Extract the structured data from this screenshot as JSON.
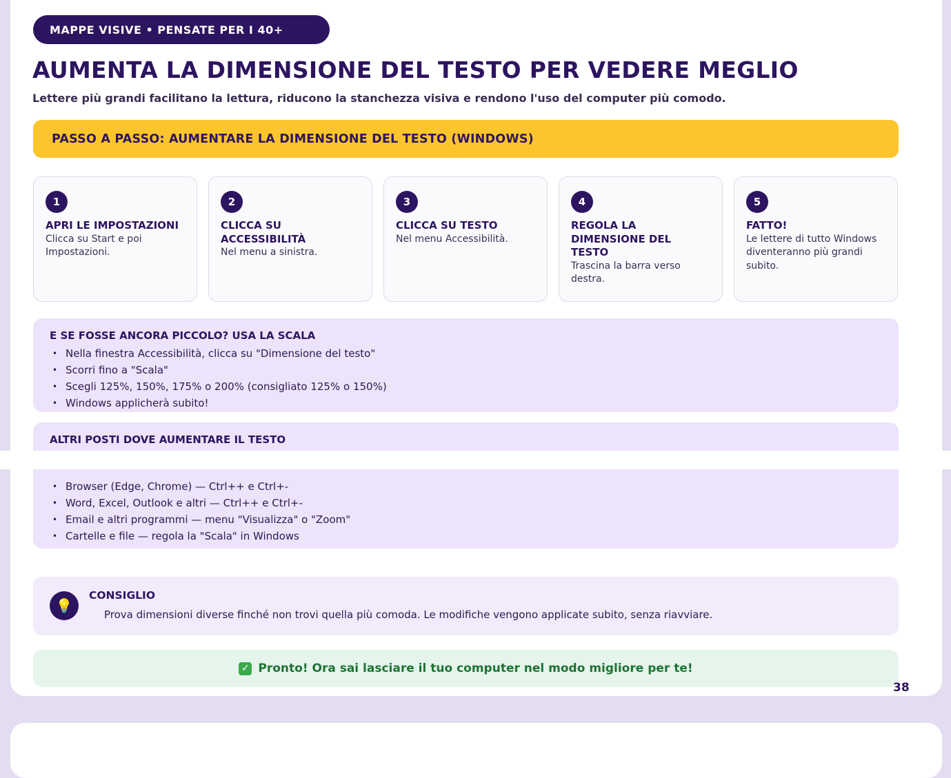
{
  "header": {
    "pill": "MAPPE VISIVE • PENSATE PER I 40+",
    "title": "AUMENTA LA DIMENSIONE DEL TESTO PER VEDERE MEGLIO",
    "subtitle": "Lettere più grandi facilitano la lettura, riducono la stanchezza visiva e rendono l'uso del computer più comodo."
  },
  "banner": {
    "label": "PASSO A PASSO: AUMENTARE LA DIMENSIONE DEL TESTO (WINDOWS)"
  },
  "steps": [
    {
      "num": "1",
      "title": "APRI LE IMPOSTAZIONI",
      "desc": "Clicca su Start e poi Impostazioni."
    },
    {
      "num": "2",
      "title": "CLICCA SU ACCESSIBILITÀ",
      "desc": "Nel menu a sinistra."
    },
    {
      "num": "3",
      "title": "CLICCA SU TESTO",
      "desc": "Nel menu Accessibilità."
    },
    {
      "num": "4",
      "title": "REGOLA LA DIMENSIONE DEL TESTO",
      "desc": "Trascina la barra verso destra."
    },
    {
      "num": "5",
      "title": "FATTO!",
      "desc": "Le lettere di tutto Windows diventeranno più grandi subito."
    }
  ],
  "scale_box": {
    "title": "E SE FOSSE ANCORA PICCOLO? USA LA SCALA",
    "items": [
      "Nella finestra Accessibilità, clicca su \"Dimensione del testo\"",
      "Scorri fino a \"Scala\"",
      "Scegli 125%, 150%, 175% o 200% (consigliato 125% o 150%)",
      "Windows applicherà subito!"
    ]
  },
  "other_box": {
    "title": "ALTRI POSTI DOVE AUMENTARE IL TESTO",
    "items": [
      "Browser (Edge, Chrome) — Ctrl++ e Ctrl+-",
      "Word, Excel, Outlook e altri — Ctrl++ e Ctrl+-",
      "Email e altri programmi — menu \"Visualizza\" o \"Zoom\"",
      "Cartelle e file — regola la \"Scala\" in Windows"
    ]
  },
  "tip": {
    "icon": "lightbulb-icon",
    "title": "CONSIGLIO",
    "text": "Prova dimensioni diverse finché non trovi quella più comoda. Le modifiche vengono applicate subito, senza riavviare."
  },
  "success": {
    "icon": "check-icon",
    "text": "Pronto! Ora sai lasciare il tuo computer nel modo migliore per te!"
  },
  "page_number": "38",
  "colors": {
    "primary": "#2d1460",
    "accent": "#fdc52c",
    "box_bg": "#ede3fb",
    "success_bg": "#e5f5eb",
    "success_text": "#1e7335"
  }
}
